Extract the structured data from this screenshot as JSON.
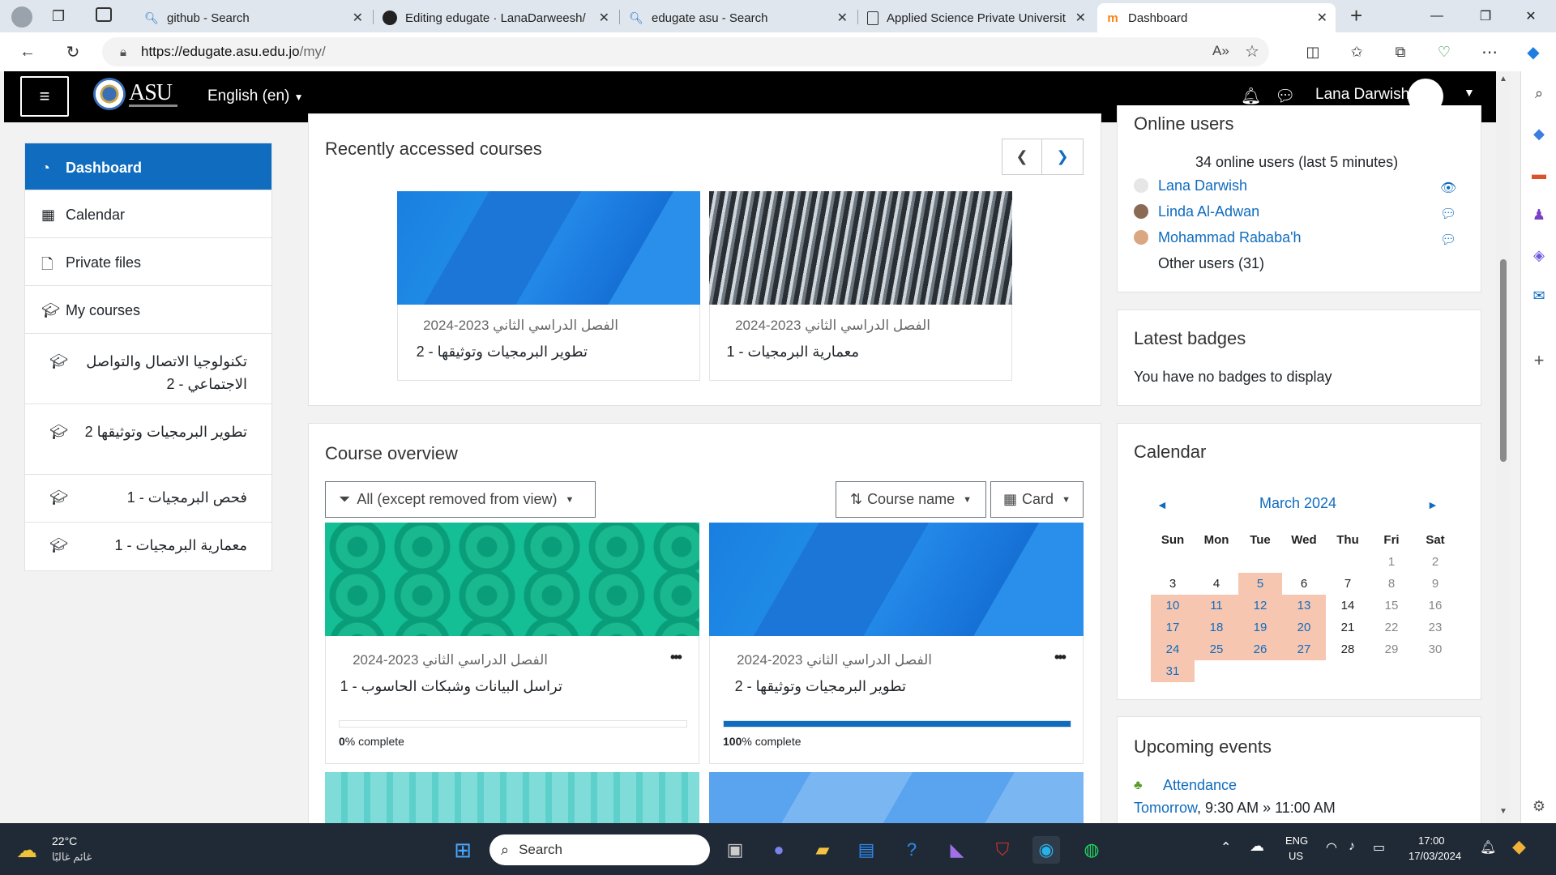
{
  "browser": {
    "tabs": [
      {
        "title": "github - Search",
        "icon": "search-icon"
      },
      {
        "title": "Editing edugate · LanaDarweesh/",
        "icon": "github-icon"
      },
      {
        "title": "edugate asu - Search",
        "icon": "search-icon"
      },
      {
        "title": "Applied Science Private Universit",
        "icon": "document-icon"
      },
      {
        "title": "Dashboard",
        "icon": "moodle-icon"
      }
    ],
    "new_tab": "+",
    "url_host": "https://edugate.asu.edu.jo",
    "url_path": "/my/"
  },
  "moodle": {
    "language": "English (en)",
    "user_name": "Lana Darwish",
    "logo_text": "ASU"
  },
  "left_nav": {
    "items": [
      {
        "label": "Dashboard",
        "icon": "dashboard-icon",
        "active": true
      },
      {
        "label": "Calendar",
        "icon": "calendar-icon"
      },
      {
        "label": "Private files",
        "icon": "file-icon"
      },
      {
        "label": "My courses",
        "icon": "graduation-cap-icon"
      }
    ],
    "courses": [
      {
        "label": "تكنولوجيا الاتصال والتواصل الاجتماعي - 2"
      },
      {
        "label": "تطوير البرمجيات وتوثيقها 2"
      },
      {
        "label": "فحص البرمجيات - 1"
      },
      {
        "label": "معمارية البرمجيات - 1"
      }
    ]
  },
  "recent": {
    "title": "Recently accessed courses",
    "courses": [
      {
        "category": "الفصل الدراسي الثاني 2023-2024",
        "name": "تطوير البرمجيات وتوثيقها - 2"
      },
      {
        "category": "الفصل الدراسي الثاني 2023-2024",
        "name": "معمارية البرمجيات - 1"
      }
    ]
  },
  "overview": {
    "title": "Course overview",
    "filter": "All (except removed from view)",
    "sort": "Course name",
    "view": "Card",
    "courses": [
      {
        "category": "الفصل الدراسي الثاني 2023-2024",
        "name": "تراسل البيانات وشبكات الحاسوب - 1",
        "progress_pct": "0",
        "progress_label": "% complete",
        "progress": 0
      },
      {
        "category": "الفصل الدراسي الثاني 2023-2024",
        "name": "تطوير البرمجيات وتوثيقها - 2",
        "progress_pct": "100",
        "progress_label": "% complete",
        "progress": 100
      }
    ]
  },
  "online_users": {
    "title": "Online users",
    "summary": "34 online users (last 5 minutes)",
    "users": [
      "Lana Darwish",
      "Linda Al-Adwan",
      "Mohammad Rababa'h"
    ],
    "others": "Other users (31)"
  },
  "badges": {
    "title": "Latest badges",
    "text": "You have no badges to display"
  },
  "calendar": {
    "title": "Calendar",
    "month": "March 2024",
    "prev": "◄",
    "next": "►",
    "headers": [
      "Sun",
      "Mon",
      "Tue",
      "Wed",
      "Thu",
      "Fri",
      "Sat"
    ],
    "weeks": [
      [
        "",
        "",
        "",
        "",
        "",
        "1",
        "2"
      ],
      [
        "3",
        "4",
        "5",
        "6",
        "7",
        "8",
        "9"
      ],
      [
        "10",
        "11",
        "12",
        "13",
        "14",
        "15",
        "16"
      ],
      [
        "17",
        "18",
        "19",
        "20",
        "21",
        "22",
        "23"
      ],
      [
        "24",
        "25",
        "26",
        "27",
        "28",
        "29",
        "30"
      ],
      [
        "31",
        "",
        "",
        "",
        "",
        "",
        ""
      ]
    ],
    "highlight_color": "#f7c6b1"
  },
  "events": {
    "title": "Upcoming events",
    "name": "Attendance",
    "day": "Tomorrow",
    "time": ", 9:30 AM » 11:00 AM"
  },
  "taskbar": {
    "temp": "22°C",
    "weather": "غائم غالبًا",
    "search": "Search",
    "lang1": "ENG",
    "lang2": "US",
    "time": "17:00",
    "date": "17/03/2024"
  },
  "colors": {
    "primary": "#0f6cbf",
    "navbar": "#000000"
  }
}
